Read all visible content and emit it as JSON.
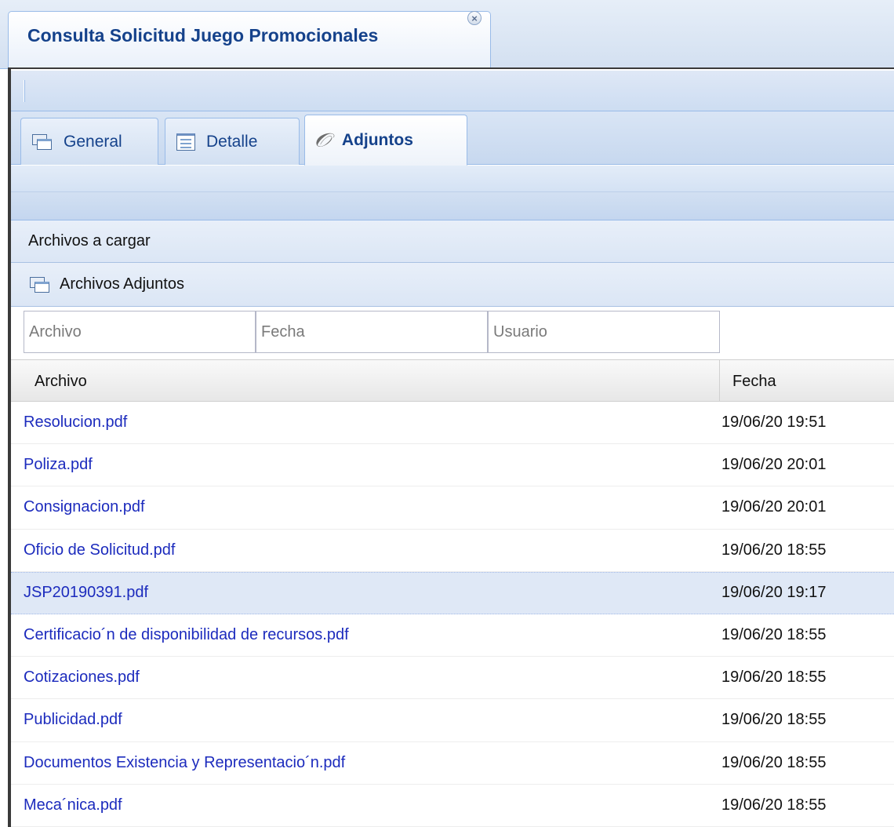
{
  "window_tab": {
    "title": "Consulta Solicitud Juego Promocionales",
    "close_icon": "close-icon"
  },
  "tabs": [
    {
      "label": "General",
      "icon": "windows-icon",
      "active": false
    },
    {
      "label": "Detalle",
      "icon": "form-icon",
      "active": false
    },
    {
      "label": "Adjuntos",
      "icon": "paperclip-icon",
      "active": true
    }
  ],
  "sections": {
    "upload_title": "Archivos a cargar",
    "attachments_title": "Archivos Adjuntos"
  },
  "filters": {
    "archivo_placeholder": "Archivo",
    "fecha_placeholder": "Fecha",
    "usuario_placeholder": "Usuario"
  },
  "grid": {
    "columns": [
      "Archivo",
      "Fecha"
    ],
    "rows": [
      {
        "archivo": "Resolucion.pdf",
        "fecha": "19/06/20 19:51",
        "selected": false
      },
      {
        "archivo": "Poliza.pdf",
        "fecha": "19/06/20 20:01",
        "selected": false
      },
      {
        "archivo": "Consignacion.pdf",
        "fecha": "19/06/20 20:01",
        "selected": false
      },
      {
        "archivo": "Oficio de Solicitud.pdf",
        "fecha": "19/06/20 18:55",
        "selected": false
      },
      {
        "archivo": "JSP20190391.pdf",
        "fecha": "19/06/20 19:17",
        "selected": true
      },
      {
        "archivo": "Certificacio´n de disponibilidad de recursos.pdf",
        "fecha": "19/06/20 18:55",
        "selected": false
      },
      {
        "archivo": "Cotizaciones.pdf",
        "fecha": "19/06/20 18:55",
        "selected": false
      },
      {
        "archivo": "Publicidad.pdf",
        "fecha": "19/06/20 18:55",
        "selected": false
      },
      {
        "archivo": "Documentos Existencia y Representacio´n.pdf",
        "fecha": "19/06/20 18:55",
        "selected": false
      },
      {
        "archivo": "Meca´nica.pdf",
        "fecha": "19/06/20 18:55",
        "selected": false
      }
    ]
  },
  "colors": {
    "link": "#1c2bbd",
    "tab_text": "#15428b",
    "border": "#99bbe8",
    "selected_row": "#dfe8f6"
  }
}
